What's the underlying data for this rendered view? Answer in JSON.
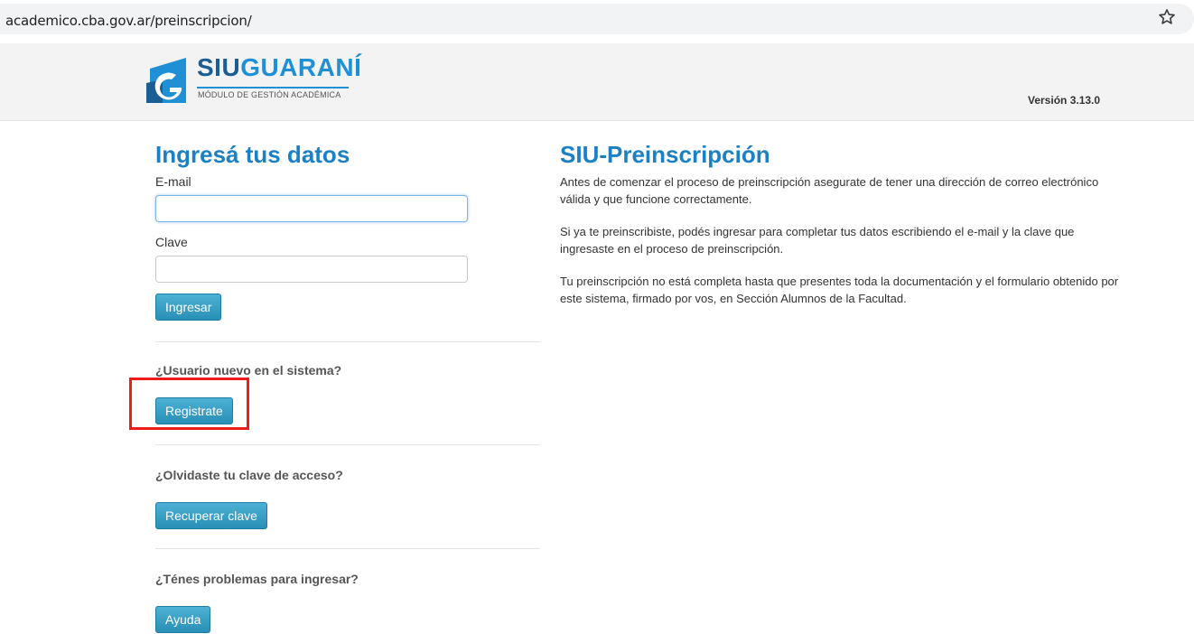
{
  "browser": {
    "url": "academico.cba.gov.ar/preinscripcion/",
    "bookmark_icon": "star-outline-icon"
  },
  "header": {
    "logo_siu": "SIU",
    "logo_guarani": "GUARANÍ",
    "logo_subtitle": "MÓDULO DE GESTIÓN ACADÉMICA",
    "version": "Versión 3.13.0",
    "brand_color": "#1b80c4"
  },
  "login": {
    "title": "Ingresá tus datos",
    "email_label": "E-mail",
    "email_value": "",
    "clave_label": "Clave",
    "clave_value": "",
    "submit_label": "Ingresar"
  },
  "sections": [
    {
      "question": "¿Usuario nuevo en el sistema?",
      "button": "Registrate",
      "highlighted": true
    },
    {
      "question": "¿Olvidaste tu clave de acceso?",
      "button": "Recuperar clave",
      "highlighted": false
    },
    {
      "question": "¿Ténes problemas para ingresar?",
      "button": "Ayuda",
      "highlighted": false
    }
  ],
  "info": {
    "title": "SIU-Preinscripción",
    "paragraphs": [
      "Antes de comenzar el proceso de preinscripción asegurate de tener una dirección de correo electrónico válida y que funcione correctamente.",
      "Si ya te preinscribiste, podés ingresar para completar tus datos escribiendo el e-mail y la clave que ingresaste en el proceso de preinscripción.",
      "Tu preinscripción no está completa hasta que presentes toda la documentación y el formulario obtenido por este sistema, firmado por vos, en Sección Alumnos de la Facultad."
    ]
  },
  "colors": {
    "button": "#2e9bc1",
    "highlight": "#ee1c1c"
  }
}
